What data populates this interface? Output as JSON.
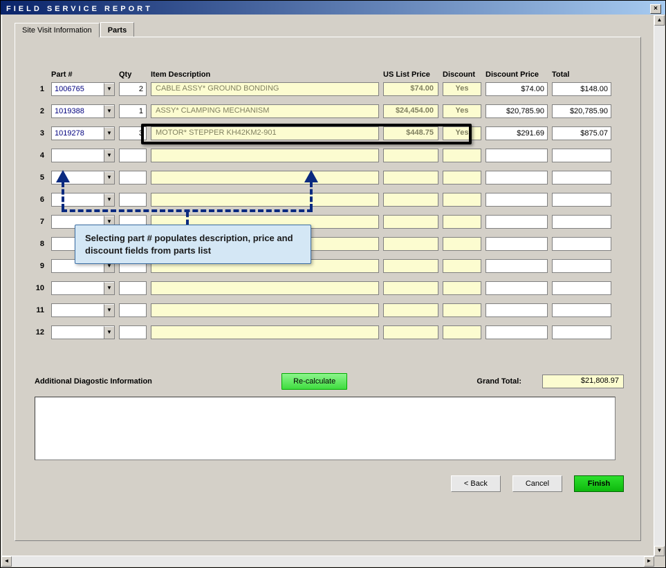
{
  "window": {
    "title": "FIELD SERVICE REPORT"
  },
  "tabs": {
    "site_visit": "Site Visit Information",
    "parts": "Parts"
  },
  "headers": {
    "part_no": "Part #",
    "qty": "Qty",
    "desc": "Item Description",
    "us_list": "US List Price",
    "discount": "Discount",
    "disc_price": "Discount Price",
    "total": "Total"
  },
  "rows": [
    {
      "n": "1",
      "part": "1006765",
      "qty": "2",
      "desc": "CABLE ASSY* GROUND BONDING",
      "list": "$74.00",
      "disc": "Yes",
      "dprice": "$74.00",
      "total": "$148.00"
    },
    {
      "n": "2",
      "part": "1019388",
      "qty": "1",
      "desc": "ASSY* CLAMPING MECHANISM",
      "list": "$24,454.00",
      "disc": "Yes",
      "dprice": "$20,785.90",
      "total": "$20,785.90"
    },
    {
      "n": "3",
      "part": "1019278",
      "qty": "3",
      "desc": "MOTOR* STEPPER KH42KM2-901",
      "list": "$448.75",
      "disc": "Yes",
      "dprice": "$291.69",
      "total": "$875.07"
    },
    {
      "n": "4",
      "part": "",
      "qty": "",
      "desc": "",
      "list": "",
      "disc": "",
      "dprice": "",
      "total": ""
    },
    {
      "n": "5",
      "part": "",
      "qty": "",
      "desc": "",
      "list": "",
      "disc": "",
      "dprice": "",
      "total": ""
    },
    {
      "n": "6",
      "part": "",
      "qty": "",
      "desc": "",
      "list": "",
      "disc": "",
      "dprice": "",
      "total": ""
    },
    {
      "n": "7",
      "part": "",
      "qty": "",
      "desc": "",
      "list": "",
      "disc": "",
      "dprice": "",
      "total": ""
    },
    {
      "n": "8",
      "part": "",
      "qty": "",
      "desc": "",
      "list": "",
      "disc": "",
      "dprice": "",
      "total": ""
    },
    {
      "n": "9",
      "part": "",
      "qty": "",
      "desc": "",
      "list": "",
      "disc": "",
      "dprice": "",
      "total": ""
    },
    {
      "n": "10",
      "part": "",
      "qty": "",
      "desc": "",
      "list": "",
      "disc": "",
      "dprice": "",
      "total": ""
    },
    {
      "n": "11",
      "part": "",
      "qty": "",
      "desc": "",
      "list": "",
      "disc": "",
      "dprice": "",
      "total": ""
    },
    {
      "n": "12",
      "part": "",
      "qty": "",
      "desc": "",
      "list": "",
      "disc": "",
      "dprice": "",
      "total": ""
    }
  ],
  "annotation": "Selecting part # populates description, price and discount fields from parts list",
  "footer": {
    "recalc": "Re-calculate",
    "grand_label": "Grand Total:",
    "grand_value": "$21,808.97",
    "diag_label": "Additional Diagostic Information",
    "back": "< Back",
    "cancel": "Cancel",
    "finish": "Finish"
  }
}
